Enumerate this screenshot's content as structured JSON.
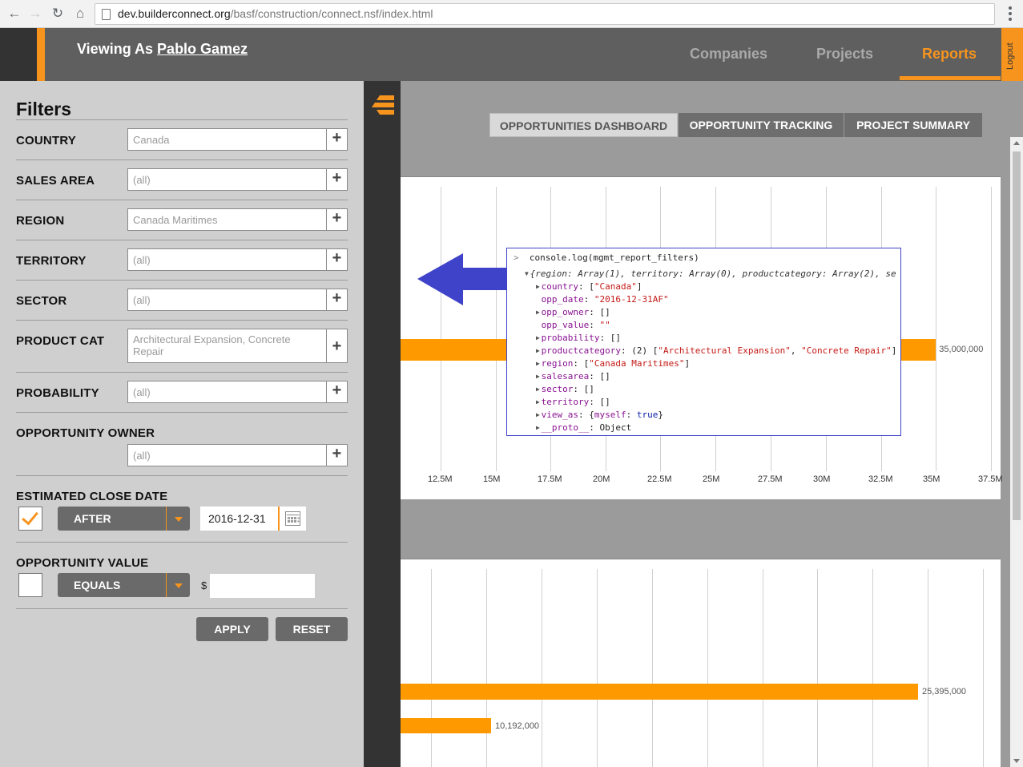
{
  "browser": {
    "url_host": "dev.builderconnect.org",
    "url_path": "/basf/construction/connect.nsf/index.html"
  },
  "header": {
    "viewing_as_prefix": "Viewing As",
    "viewing_as_user": "Pablo Gamez",
    "nav": [
      "Companies",
      "Projects",
      "Reports"
    ],
    "active_nav": "Reports",
    "logout": "Logout"
  },
  "filters": {
    "title": "Filters",
    "rows": [
      {
        "label": "COUNTRY",
        "value": "Canada"
      },
      {
        "label": "SALES AREA",
        "value": "(all)"
      },
      {
        "label": "REGION",
        "value": "Canada Maritimes"
      },
      {
        "label": "TERRITORY",
        "value": "(all)"
      },
      {
        "label": "SECTOR",
        "value": "(all)"
      },
      {
        "label": "PRODUCT CAT",
        "value": "Architectural Expansion, Concrete Repair"
      },
      {
        "label": "PROBABILITY",
        "value": "(all)"
      },
      {
        "label": "OPPORTUNITY OWNER",
        "value": "(all)"
      }
    ],
    "close_date": {
      "label": "ESTIMATED CLOSE DATE",
      "checked": true,
      "operator": "AFTER",
      "date": "2016-12-31"
    },
    "opp_value": {
      "label": "OPPORTUNITY VALUE",
      "checked": false,
      "operator": "EQUALS",
      "currency": "$",
      "amount": ""
    },
    "apply": "APPLY",
    "reset": "RESET"
  },
  "tabs": [
    "OPPORTUNITIES DASHBOARD",
    "OPPORTUNITY TRACKING",
    "PROJECT SUMMARY"
  ],
  "active_tab": "OPPORTUNITIES DASHBOARD",
  "chart_data": [
    {
      "type": "bar",
      "orientation": "horizontal",
      "x_ticks": [
        "12.5M",
        "15M",
        "17.5M",
        "20M",
        "22.5M",
        "25M",
        "27.5M",
        "30M",
        "32.5M",
        "35M",
        "37.5M"
      ],
      "values": [
        35000000
      ],
      "value_labels": [
        "35,000,000"
      ],
      "grid": true
    },
    {
      "type": "bar",
      "orientation": "horizontal",
      "values": [
        25395000,
        10192000
      ],
      "value_labels": [
        "25,395,000",
        "10,192,000"
      ],
      "grid": true
    }
  ],
  "console": {
    "command": "console.log(mgmt_report_filters)",
    "summary": "{region: Array(1), territory: Array(0), productcategory: Array(2), se",
    "lines": [
      {
        "key": "country",
        "value": "[\"Canada\"]",
        "expandable": true
      },
      {
        "key": "opp_date",
        "value": "\"2016-12-31AF\"",
        "expandable": false
      },
      {
        "key": "opp_owner",
        "value": "[]",
        "expandable": true
      },
      {
        "key": "opp_value",
        "value": "\"\"",
        "expandable": false
      },
      {
        "key": "probability",
        "value": "[]",
        "expandable": true
      },
      {
        "key": "productcategory",
        "value": "(2) [\"Architectural Expansion\", \"Concrete Repair\"]",
        "expandable": true
      },
      {
        "key": "region",
        "value": "[\"Canada Maritimes\"]",
        "expandable": true
      },
      {
        "key": "salesarea",
        "value": "[]",
        "expandable": true
      },
      {
        "key": "sector",
        "value": "[]",
        "expandable": true
      },
      {
        "key": "territory",
        "value": "[]",
        "expandable": true
      },
      {
        "key": "view_as",
        "value": "{myself: true}",
        "expandable": true
      },
      {
        "key": "__proto__",
        "value": "Object",
        "expandable": true
      }
    ]
  },
  "colors": {
    "accent": "#f7941d",
    "bar": "#fe9a00",
    "arrow": "#3f43c9"
  }
}
